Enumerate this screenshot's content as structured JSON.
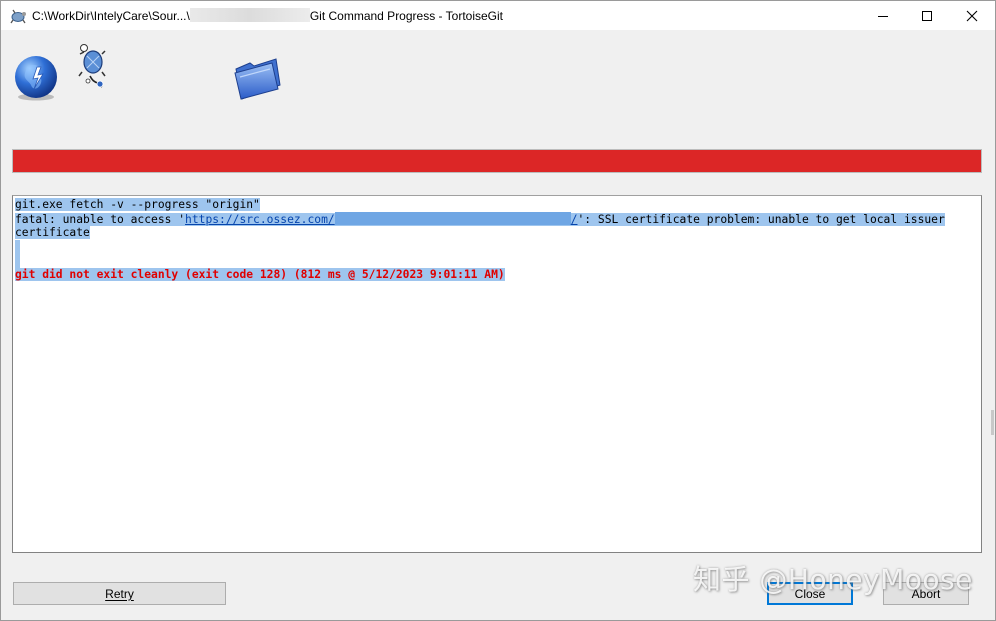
{
  "window": {
    "title_prefix": "C:\\WorkDir\\IntelyCare\\Sour...\\",
    "title_suffix": "Git Command Progress - TortoiseGit"
  },
  "toolbar": {
    "icons": [
      "globe-icon",
      "tortoise-icon",
      "folder-icon"
    ]
  },
  "progress": {
    "percent": 100,
    "color": "#dc2626"
  },
  "log": {
    "line1": "git.exe fetch -v --progress \"origin\"",
    "line2_pre": "fatal: unable to access '",
    "line2_link": "https://src.ossez.com/",
    "line2_link_end": "/",
    "line2_post": "': SSL certificate problem: unable to get local issuer",
    "line3": "certificate",
    "line6": "git did not exit cleanly (exit code 128) (812 ms @ 5/12/2023 9:01:11 AM)"
  },
  "buttons": {
    "retry": "Retry",
    "close": "Close",
    "abort": "Abort"
  },
  "watermark": "知乎 @HoneyMoose",
  "colors": {
    "selection": "#9ec5ee",
    "error_text": "#e00000",
    "accent": "#0078d7"
  }
}
